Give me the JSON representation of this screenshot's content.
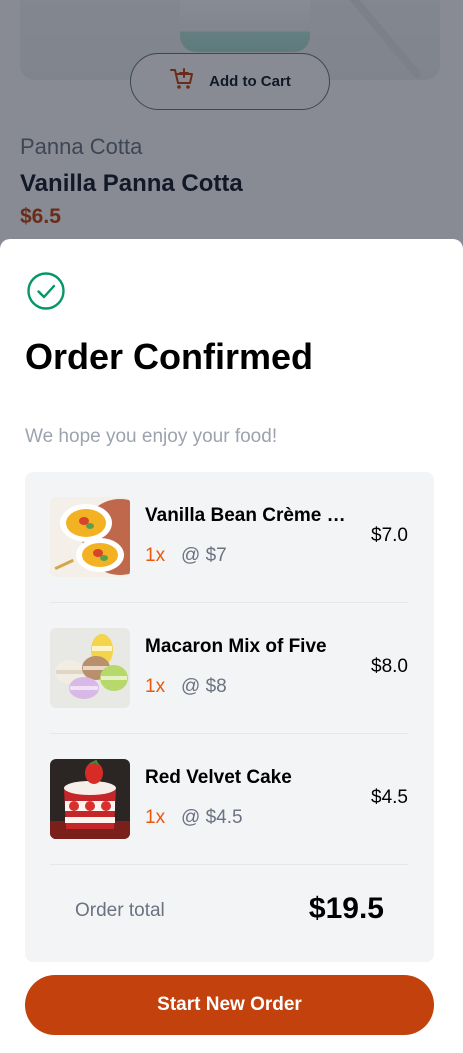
{
  "product": {
    "add_to_cart_label": "Add to Cart",
    "category": "Panna Cotta",
    "name": "Vanilla Panna Cotta",
    "price": "$6.5"
  },
  "confirmation": {
    "title": "Order Confirmed",
    "subtitle": "We hope you enjoy your food!",
    "items": [
      {
        "name": "Vanilla Bean Crème Brûlée",
        "qty": "1x",
        "unit_price": "@ $7",
        "line_total": "$7.0",
        "image": "creme-brulee-photo"
      },
      {
        "name": "Macaron Mix of Five",
        "qty": "1x",
        "unit_price": "@ $8",
        "line_total": "$8.0",
        "image": "macarons-photo"
      },
      {
        "name": "Red Velvet Cake",
        "qty": "1x",
        "unit_price": "@ $4.5",
        "line_total": "$4.5",
        "image": "red-velvet-cake-photo"
      }
    ],
    "total_label": "Order total",
    "total_value": "$19.5",
    "start_new_order_label": "Start New Order"
  },
  "colors": {
    "accent": "#c2410c",
    "success": "#059669",
    "qty": "#ea580c",
    "muted": "#6b7280",
    "panel": "#f3f4f6"
  },
  "icons": {
    "add_to_cart": "cart-plus-icon",
    "confirmed": "check-circle-icon"
  }
}
